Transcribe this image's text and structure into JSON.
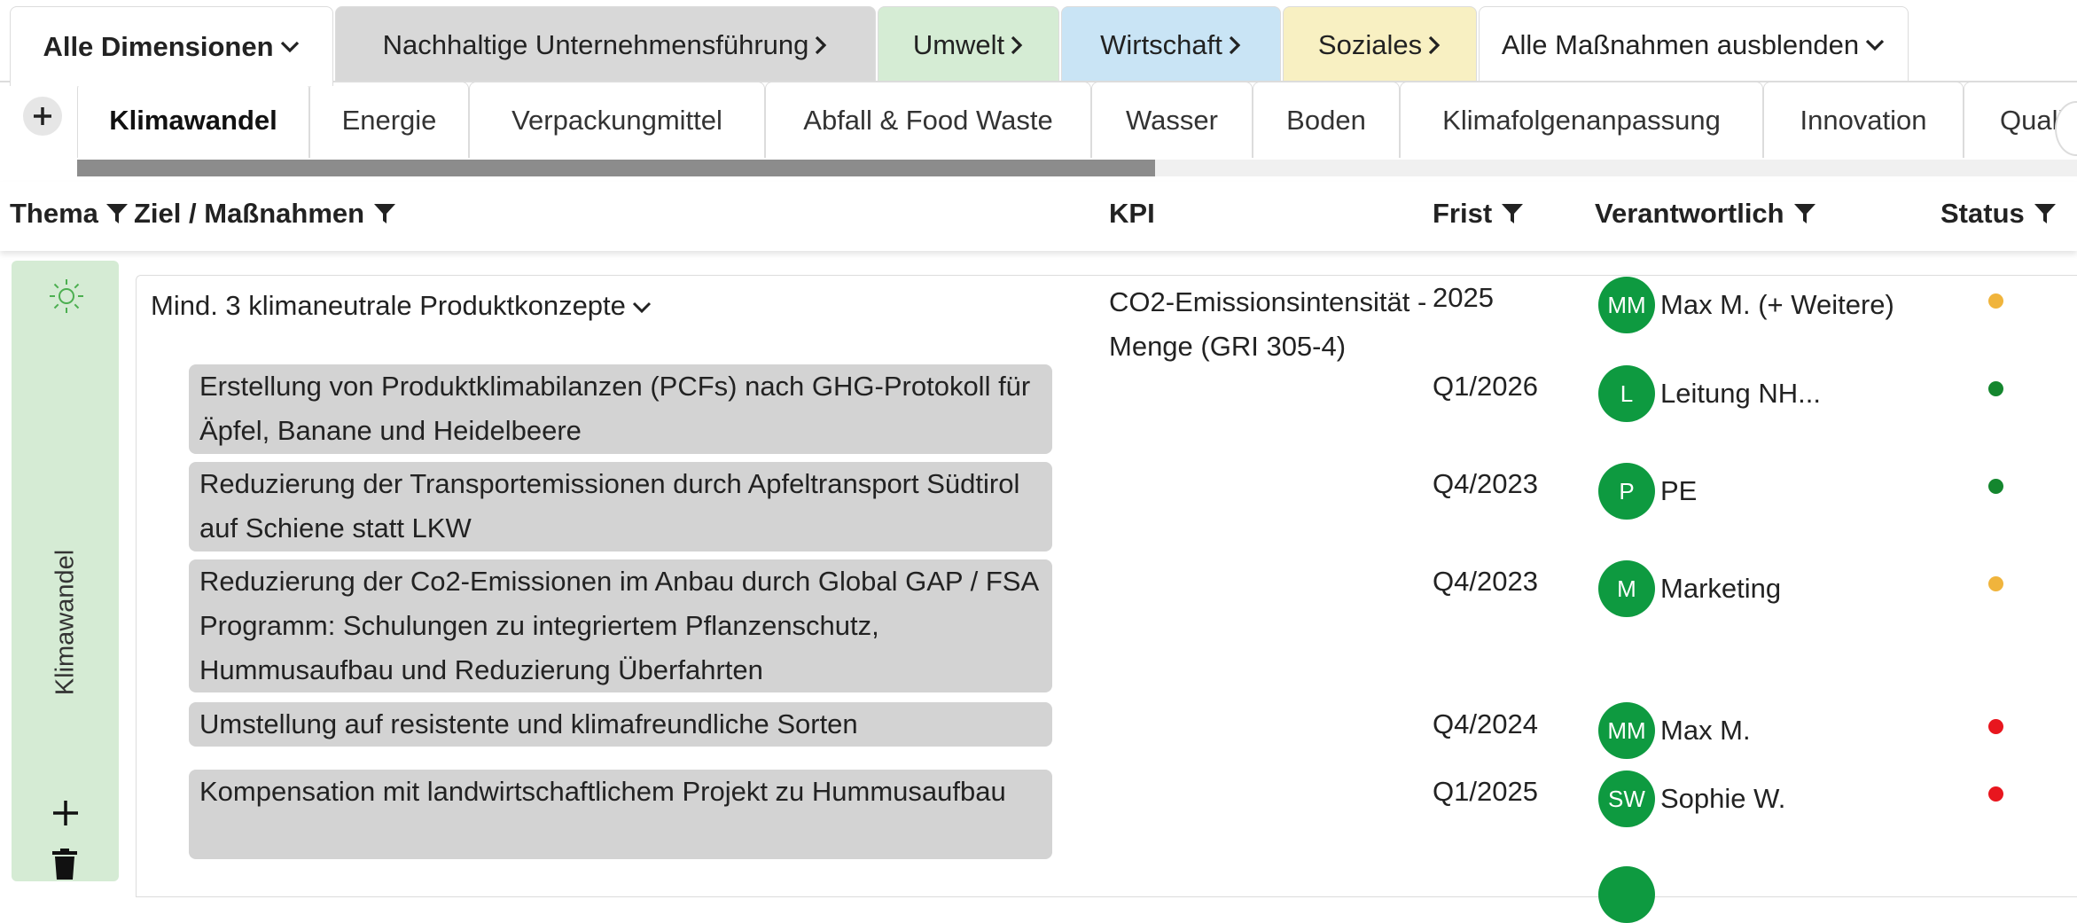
{
  "dimensions": {
    "all": "Alle Dimensionen",
    "nachhaltig": "Nachhaltige Unternehmensführung",
    "umwelt": "Umwelt",
    "wirtschaft": "Wirtschaft",
    "soziales": "Soziales",
    "hide_measures": "Alle Maßnahmen ausblenden"
  },
  "themes": {
    "tabs": [
      "Klimawandel",
      "Energie",
      "Verpackungmittel",
      "Abfall & Food Waste",
      "Wasser",
      "Boden",
      "Klimafolgenanpassung",
      "Innovation",
      "Quali"
    ],
    "active": "Klimawandel"
  },
  "columns": {
    "thema": "Thema",
    "ziel": "Ziel / Maßnahmen",
    "kpi": "KPI",
    "frist": "Frist",
    "verantwortlich": "Verantwortlich",
    "status": "Status"
  },
  "side": {
    "theme_label": "Klimawandel",
    "icon": "sun-icon",
    "color": "#d5ebd4"
  },
  "goal": {
    "title": "Mind. 3 klimaneutrale Produktkonzepte",
    "kpi": "CO2-Emissionsintensität - Menge (GRI 305-4)",
    "frist": "2025",
    "responsible_initials": "MM",
    "responsible_name": "Max M. (+ Weitere)",
    "status_color": "#f0b43c"
  },
  "measures": [
    {
      "text": "Erstellung von Produktklimabilanzen (PCFs) nach GHG-Protokoll für Äpfel, Banane und Heidelbeere",
      "frist": "Q1/2026",
      "initials": "L",
      "name": "Leitung NH...",
      "status_color": "#14862e"
    },
    {
      "text": "Reduzierung der Transportemissionen durch Apfeltransport Südtirol auf Schiene statt LKW",
      "frist": "Q4/2023",
      "initials": "P",
      "name": "PE",
      "status_color": "#14862e"
    },
    {
      "text": "Reduzierung der Co2-Emissionen im Anbau durch Global GAP / FSA Programm: Schulungen zu integriertem Pflanzenschutz, Hummusaufbau und Reduzierung Überfahrten",
      "frist": "Q4/2023",
      "initials": "M",
      "name": "Marketing",
      "status_color": "#f0b43c"
    },
    {
      "text": "Umstellung auf resistente und klimafreundliche Sorten",
      "frist": "Q4/2024",
      "initials": "MM",
      "name": "Max M.",
      "status_color": "#e8161e"
    },
    {
      "text": "Kompensation mit landwirtschaftlichem Projekt zu Hummusaufbau",
      "frist": "Q1/2025",
      "initials": "SW",
      "name": "Sophie W.",
      "status_color": "#e8161e"
    }
  ],
  "colors": {
    "avatar": "#0e9a40",
    "measure_bg": "#d3d3d3",
    "umwelt": "#d5ecd4",
    "wirtschaft": "#c9e4f5",
    "soziales": "#f8f0c2",
    "nachhaltig": "#d8d8d8"
  }
}
